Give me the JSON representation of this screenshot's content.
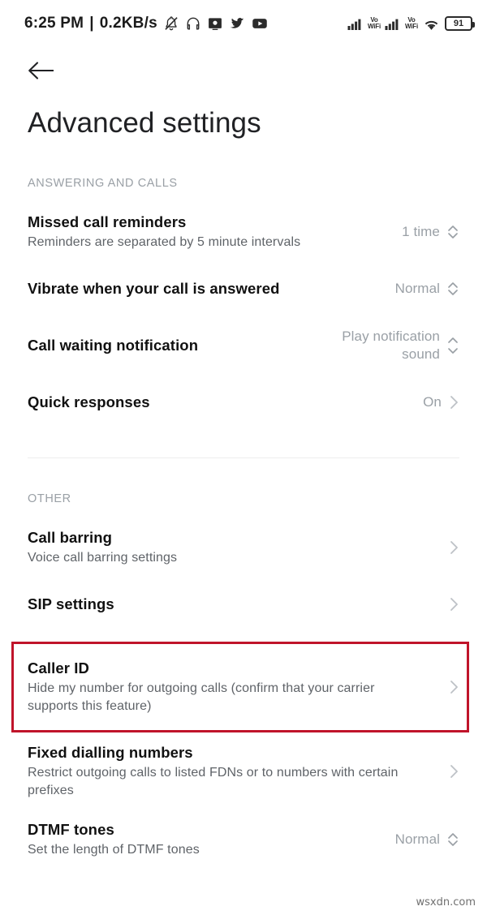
{
  "status_bar": {
    "clock": "6:25 PM",
    "separator": "|",
    "data_rate": "0.2KB/s",
    "left_icons": [
      "bell-muted-icon",
      "headphones-icon",
      "screenshot-app-icon",
      "twitter-icon",
      "youtube-icon"
    ],
    "sim1_label": "Vo\nWiFi",
    "sim1_line1": "Vo",
    "sim1_line2": "WiFi",
    "sim2_line1": "Vo",
    "sim2_line2": "WiFi",
    "battery_percent": "91"
  },
  "nav": {
    "back_label": "Back"
  },
  "header": {
    "title": "Advanced settings"
  },
  "sections": [
    {
      "id": "answering",
      "label": "ANSWERING AND CALLS",
      "rows": [
        {
          "title": "Missed call reminders",
          "subtitle": "Reminders are separated by 5 minute intervals",
          "value": "1 time",
          "control": "stepper"
        },
        {
          "title": "Vibrate when your call is answered",
          "subtitle": "",
          "value": "Normal",
          "control": "stepper"
        },
        {
          "title": "Call waiting notification",
          "subtitle": "",
          "value": "Play notification sound",
          "control": "stepper"
        },
        {
          "title": "Quick responses",
          "subtitle": "",
          "value": "On",
          "control": "chevron"
        }
      ]
    },
    {
      "id": "other",
      "label": "OTHER",
      "rows": [
        {
          "title": "Call barring",
          "subtitle": "Voice call barring settings",
          "value": "",
          "control": "chevron"
        },
        {
          "title": "SIP settings",
          "subtitle": "",
          "value": "",
          "control": "chevron"
        },
        {
          "title": "Caller ID",
          "subtitle": "Hide my number for outgoing calls (confirm that your carrier supports this feature)",
          "value": "",
          "control": "chevron",
          "highlighted": true
        },
        {
          "title": "Fixed dialling numbers",
          "subtitle": "Restrict outgoing calls to listed FDNs or to numbers with certain prefixes",
          "value": "",
          "control": "chevron"
        },
        {
          "title": "DTMF tones",
          "subtitle": "Set the length of DTMF tones",
          "value": "Normal",
          "control": "stepper"
        }
      ]
    }
  ],
  "highlight": {
    "color": "#c0142a"
  },
  "watermark": {
    "text": "wsxdn.com"
  }
}
